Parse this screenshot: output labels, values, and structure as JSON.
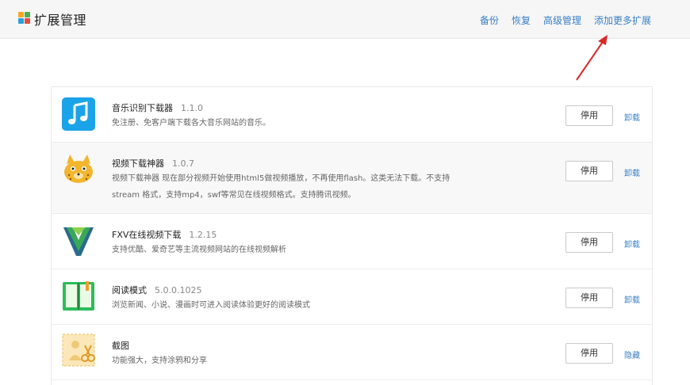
{
  "header": {
    "title": "扩展管理",
    "links": [
      "备份",
      "恢复",
      "高级管理",
      "添加更多扩展"
    ]
  },
  "extensions": [
    {
      "name": "音乐识别下载器",
      "version": "1.1.0",
      "description": [
        "免注册、免客户端下载各大音乐网站的音乐。"
      ],
      "button": "停用",
      "action": "卸载",
      "icon": "music-note-icon"
    },
    {
      "name": "视频下载神器",
      "version": "1.0.7",
      "description": [
        "视频下载神器 现在部分视频开始使用html5做视频播放，不再使用flash。这类无法下载。不支持",
        "stream 格式，支持mp4，swf等常见在线视频格式。支持腾讯视频。"
      ],
      "button": "停用",
      "action": "卸载",
      "icon": "leopard-icon"
    },
    {
      "name": "FXV在线视频下载",
      "version": "1.2.15",
      "description": [
        "支持优酷、爱奇艺等主流视频网站的在线视频解析"
      ],
      "button": "停用",
      "action": "卸载",
      "icon": "fxv-logo-icon"
    },
    {
      "name": "阅读模式",
      "version": "5.0.0.1025",
      "description": [
        "浏览新闻、小说、漫画时可进入阅读体验更好的阅读模式"
      ],
      "button": "停用",
      "action": "卸载",
      "icon": "open-book-icon"
    },
    {
      "name": "截图",
      "version": "",
      "description": [
        "功能强大，支持涂鸦和分享"
      ],
      "button": "停用",
      "action": "隐藏",
      "icon": "scissors-screenshot-icon"
    }
  ],
  "colors": {
    "link": "#3a7fc4",
    "arrow": "#d62a2a",
    "header_bg": "#f6f6f6"
  }
}
